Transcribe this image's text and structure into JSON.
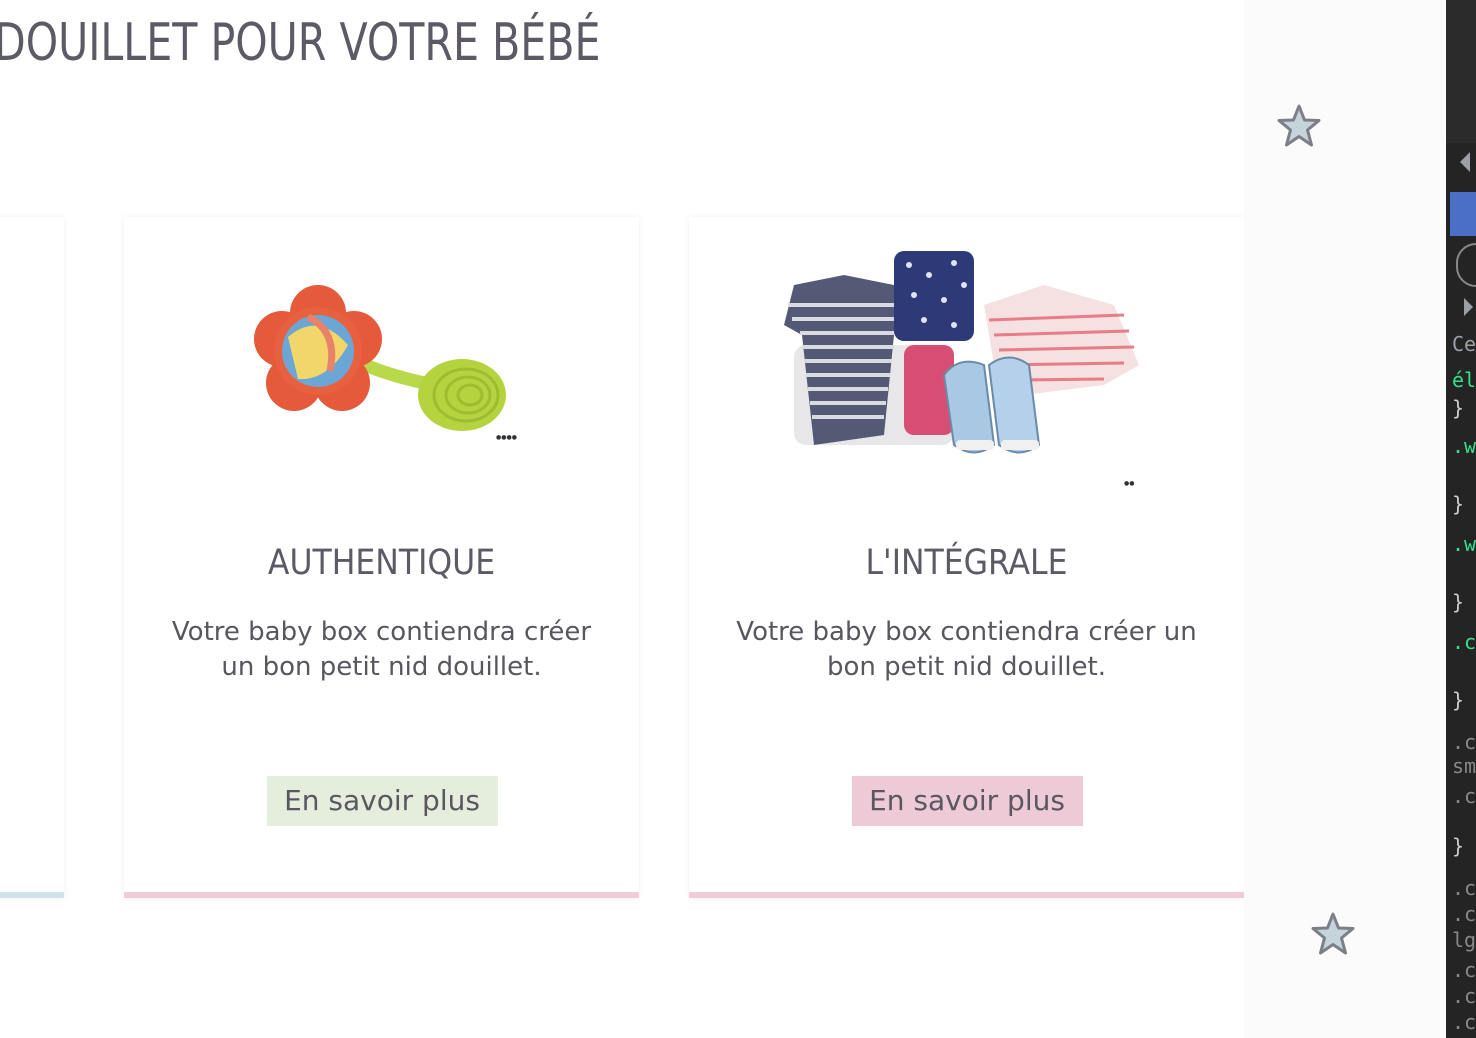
{
  "page": {
    "heading": "DOUILLET POUR VOTRE BÉBÉ"
  },
  "cards": [
    {
      "title": "AUTHENTIQUE",
      "description": "Votre baby box contiendra créer un bon petit nid douillet.",
      "button_label": "En savoir plus",
      "button_color": "#e5eedd",
      "bar_color": "#f0ccd7",
      "image": "rattle-toy-image"
    },
    {
      "title": "L'INTÉGRALE",
      "description": "Votre baby box contiendra créer un bon petit nid douillet.",
      "button_label": "En savoir plus",
      "button_color": "#eecad6",
      "bar_color": "#f0ccd7",
      "image": "baby-clothes-image"
    }
  ],
  "partial_card": {
    "bar_color": "#d3e2e8"
  },
  "decor": {
    "star_icon": "star-icon",
    "star_fill": "#c5d4da",
    "star_stroke": "#7d7e88"
  },
  "devtools": {
    "panel_name": "devtools-panel",
    "lines": [
      "Ce",
      "él",
      "}",
      ".w",
      "}",
      ".w",
      "}",
      ".c",
      "}",
      ".c",
      "sm",
      ".c",
      "}",
      ".c",
      ".c",
      "lg",
      ".c",
      ".c",
      ".c"
    ]
  }
}
